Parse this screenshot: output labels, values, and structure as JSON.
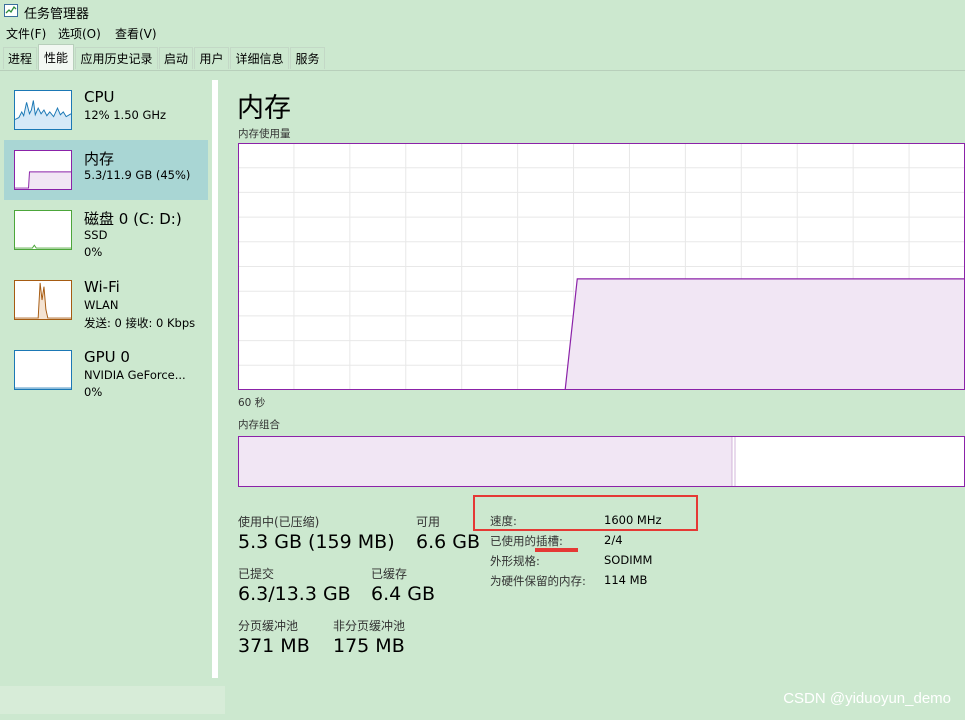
{
  "window": {
    "title": "任务管理器"
  },
  "menu": [
    {
      "label": "文件(F)"
    },
    {
      "label": "选项(O)"
    },
    {
      "label": "查看(V)"
    }
  ],
  "tabs": [
    {
      "label": "进程"
    },
    {
      "label": "性能"
    },
    {
      "label": "应用历史记录"
    },
    {
      "label": "启动"
    },
    {
      "label": "用户"
    },
    {
      "label": "详细信息"
    },
    {
      "label": "服务"
    }
  ],
  "devices": [
    {
      "name": "CPU",
      "line1": "12% 1.50 GHz",
      "line2": "",
      "color": "#1b78b5"
    },
    {
      "name": "内存",
      "line1": "5.3/11.9 GB (45%)",
      "line2": "",
      "color": "#8b22a8"
    },
    {
      "name": "磁盘 0 (C: D:)",
      "line1": "SSD",
      "line2": "0%",
      "color": "#4ca63a"
    },
    {
      "name": "Wi-Fi",
      "line1": "WLAN",
      "line2": "发送: 0 接收: 0 Kbps",
      "color": "#a65b12"
    },
    {
      "name": "GPU 0",
      "line1": "NVIDIA GeForce...",
      "line2": "0%",
      "color": "#1b78b5"
    }
  ],
  "main": {
    "title": "内存",
    "usage_label": "内存使用量",
    "time_label": "60 秒",
    "composition_label": "内存组合",
    "accent_color": "#8b22a8"
  },
  "chart_data": {
    "type": "area",
    "title": "内存使用量",
    "xlabel": "60 秒",
    "x": [
      60,
      33,
      32,
      0
    ],
    "values": [
      0,
      0,
      45,
      45
    ],
    "ylim": [
      0,
      100
    ]
  },
  "stats": {
    "in_use_label": "使用中(已压缩)",
    "in_use_value": "5.3 GB (159 MB)",
    "available_label": "可用",
    "available_value": "6.6 GB",
    "committed_label": "已提交",
    "committed_value": "6.3/13.3 GB",
    "cached_label": "已缓存",
    "cached_value": "6.4 GB",
    "paged_label": "分页缓冲池",
    "paged_value": "371 MB",
    "nonpaged_label": "非分页缓冲池",
    "nonpaged_value": "175 MB"
  },
  "details": [
    {
      "label": "速度:",
      "value": "1600 MHz"
    },
    {
      "label": "已使用的插槽:",
      "value": "2/4"
    },
    {
      "label": "外形规格:",
      "value": "SODIMM"
    },
    {
      "label": "为硬件保留的内存:",
      "value": "114 MB"
    }
  ],
  "watermark": "CSDN @yiduoyun_demo"
}
